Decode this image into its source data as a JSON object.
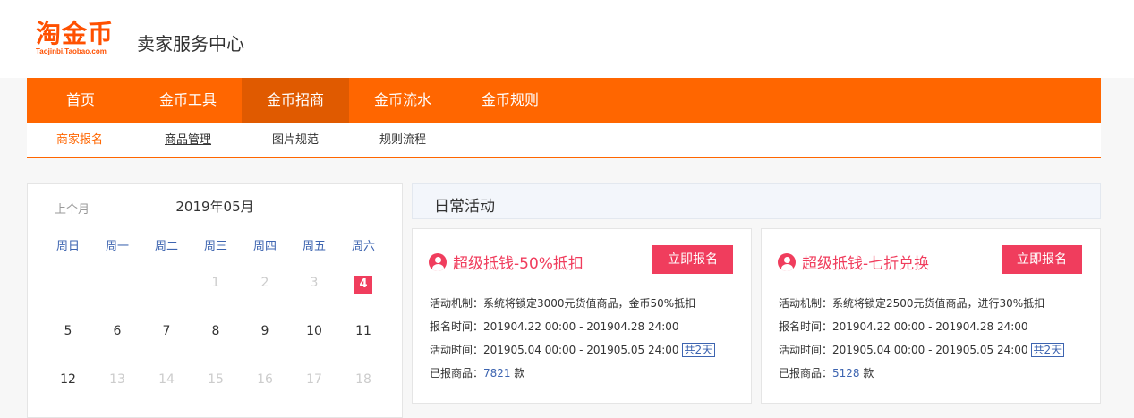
{
  "logo": {
    "main": "淘金币",
    "sub": "Taojinbi.Taobao.com"
  },
  "site_title": "卖家服务中心",
  "main_nav": [
    "首页",
    "金币工具",
    "金币招商",
    "金币流水",
    "金币规则"
  ],
  "main_nav_active": 2,
  "sub_nav": [
    "商家报名",
    "商品管理",
    "图片规范",
    "规则流程"
  ],
  "sub_nav_active": 0,
  "calendar": {
    "prev_label": "上个月",
    "title": "2019年05月",
    "weekdays": [
      "周日",
      "周一",
      "周二",
      "周三",
      "周四",
      "周五",
      "周六"
    ],
    "weeks": [
      [
        "",
        "",
        "",
        "1",
        "2",
        "3",
        "4"
      ],
      [
        "5",
        "6",
        "7",
        "8",
        "9",
        "10",
        "11"
      ],
      [
        "12",
        "13",
        "14",
        "15",
        "16",
        "17",
        "18"
      ]
    ],
    "highlight_day": "4",
    "dim_days": [
      "1",
      "2",
      "3",
      "13",
      "14",
      "15",
      "16",
      "17",
      "18"
    ]
  },
  "section_title": "日常活动",
  "cards": [
    {
      "title": "超级抵钱-50%抵扣",
      "button": "立即报名",
      "mechanism": "活动机制：系统将锁定3000元货值商品，金币50%抵扣",
      "signup_time": "报名时间：201904.22 00:00 - 201904.28 24:00",
      "activity_time": "活动时间：201905.04 00:00 - 201905.05 24:00",
      "days_badge": "共2天",
      "reported_prefix": "已报商品：",
      "reported_count": "7821",
      "reported_unit": " 款"
    },
    {
      "title": "超级抵钱-七折兑换",
      "button": "立即报名",
      "mechanism": "活动机制：系统将锁定2500元货值商品，进行30%抵扣",
      "signup_time": "报名时间：201904.22 00:00 - 201904.28 24:00",
      "activity_time": "活动时间：201905.04 00:00 - 201905.05 24:00",
      "days_badge": "共2天",
      "reported_prefix": "已报商品：",
      "reported_count": "5128",
      "reported_unit": " 款"
    }
  ],
  "colors": {
    "brand_orange": "#ff6600",
    "accent_red": "#f03d5d",
    "link_blue": "#3d64b0"
  }
}
